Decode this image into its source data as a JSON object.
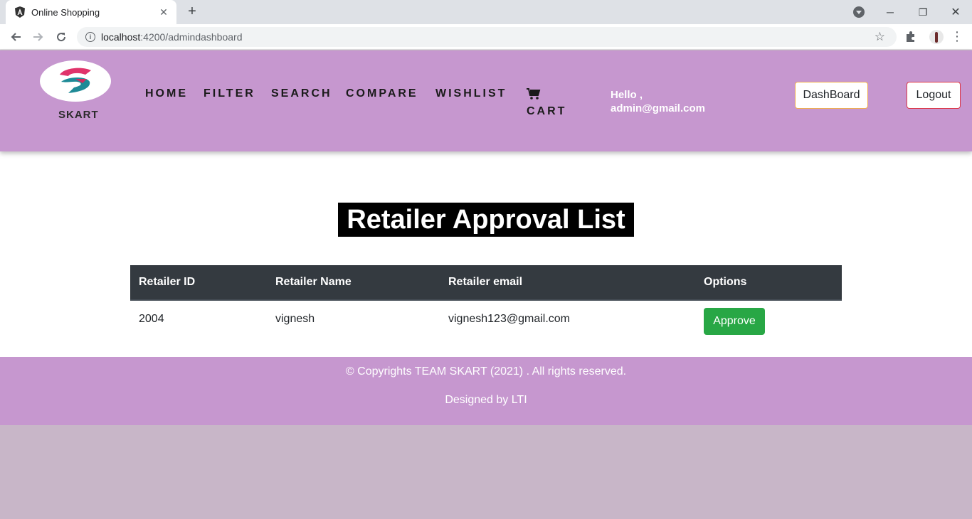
{
  "browser": {
    "tab_title": "Online Shopping",
    "url_host": "localhost",
    "url_path": ":4200/admindashboard"
  },
  "header": {
    "logo_text": "SKART",
    "nav": [
      "HOME",
      "FILTER",
      "SEARCH",
      "COMPARE",
      "WISHLIST"
    ],
    "cart_label": "CART",
    "greeting_line1": "Hello ,",
    "greeting_line2": "admin@gmail.com",
    "dashboard_label": "DashBoard",
    "logout_label": "Logout"
  },
  "main": {
    "title": "Retailer Approval List",
    "table": {
      "headers": [
        "Retailer ID",
        "Retailer Name",
        "Retailer email",
        "Options"
      ],
      "rows": [
        {
          "id": "2004",
          "name": "vignesh",
          "email": "vignesh123@gmail.com",
          "action": "Approve"
        }
      ]
    }
  },
  "footer": {
    "copyright": "© Copyrights TEAM SKART (2021) . All rights reserved.",
    "designed_by": "Designed by LTI"
  },
  "colors": {
    "header_bg": "#c697cf",
    "table_header_bg": "#343a40",
    "approve_green": "#28a745",
    "page_bg": "#c8b6c8"
  }
}
